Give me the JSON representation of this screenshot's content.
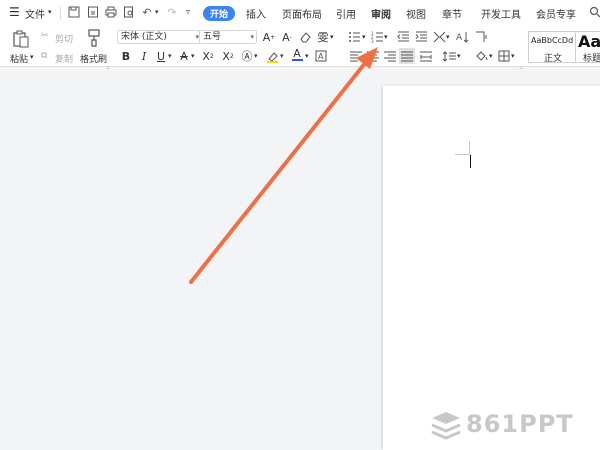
{
  "menu": {
    "file_label": "文件",
    "tabs": [
      "开始",
      "插入",
      "页面布局",
      "引用",
      "审阅",
      "视图",
      "章节",
      "开发工具",
      "会员专享"
    ],
    "active_tab": "开始"
  },
  "ribbon": {
    "paste_label": "粘贴",
    "cut_label": "剪切",
    "copy_label": "复制",
    "format_painter_label": "格式刷",
    "font_name": "宋体 (正文)",
    "font_size": "五号",
    "style_preview_normal": "AaBbCcDd",
    "style_name_normal": "正文",
    "style_preview_heading": "Aa",
    "style_name_heading": "标题"
  },
  "watermark": {
    "text": "861PPT"
  },
  "colors": {
    "accent": "#3b82f6",
    "arrow": "#f07046",
    "font_color_bar": "#2a52ff",
    "highlight_bar": "#f5d90a"
  }
}
